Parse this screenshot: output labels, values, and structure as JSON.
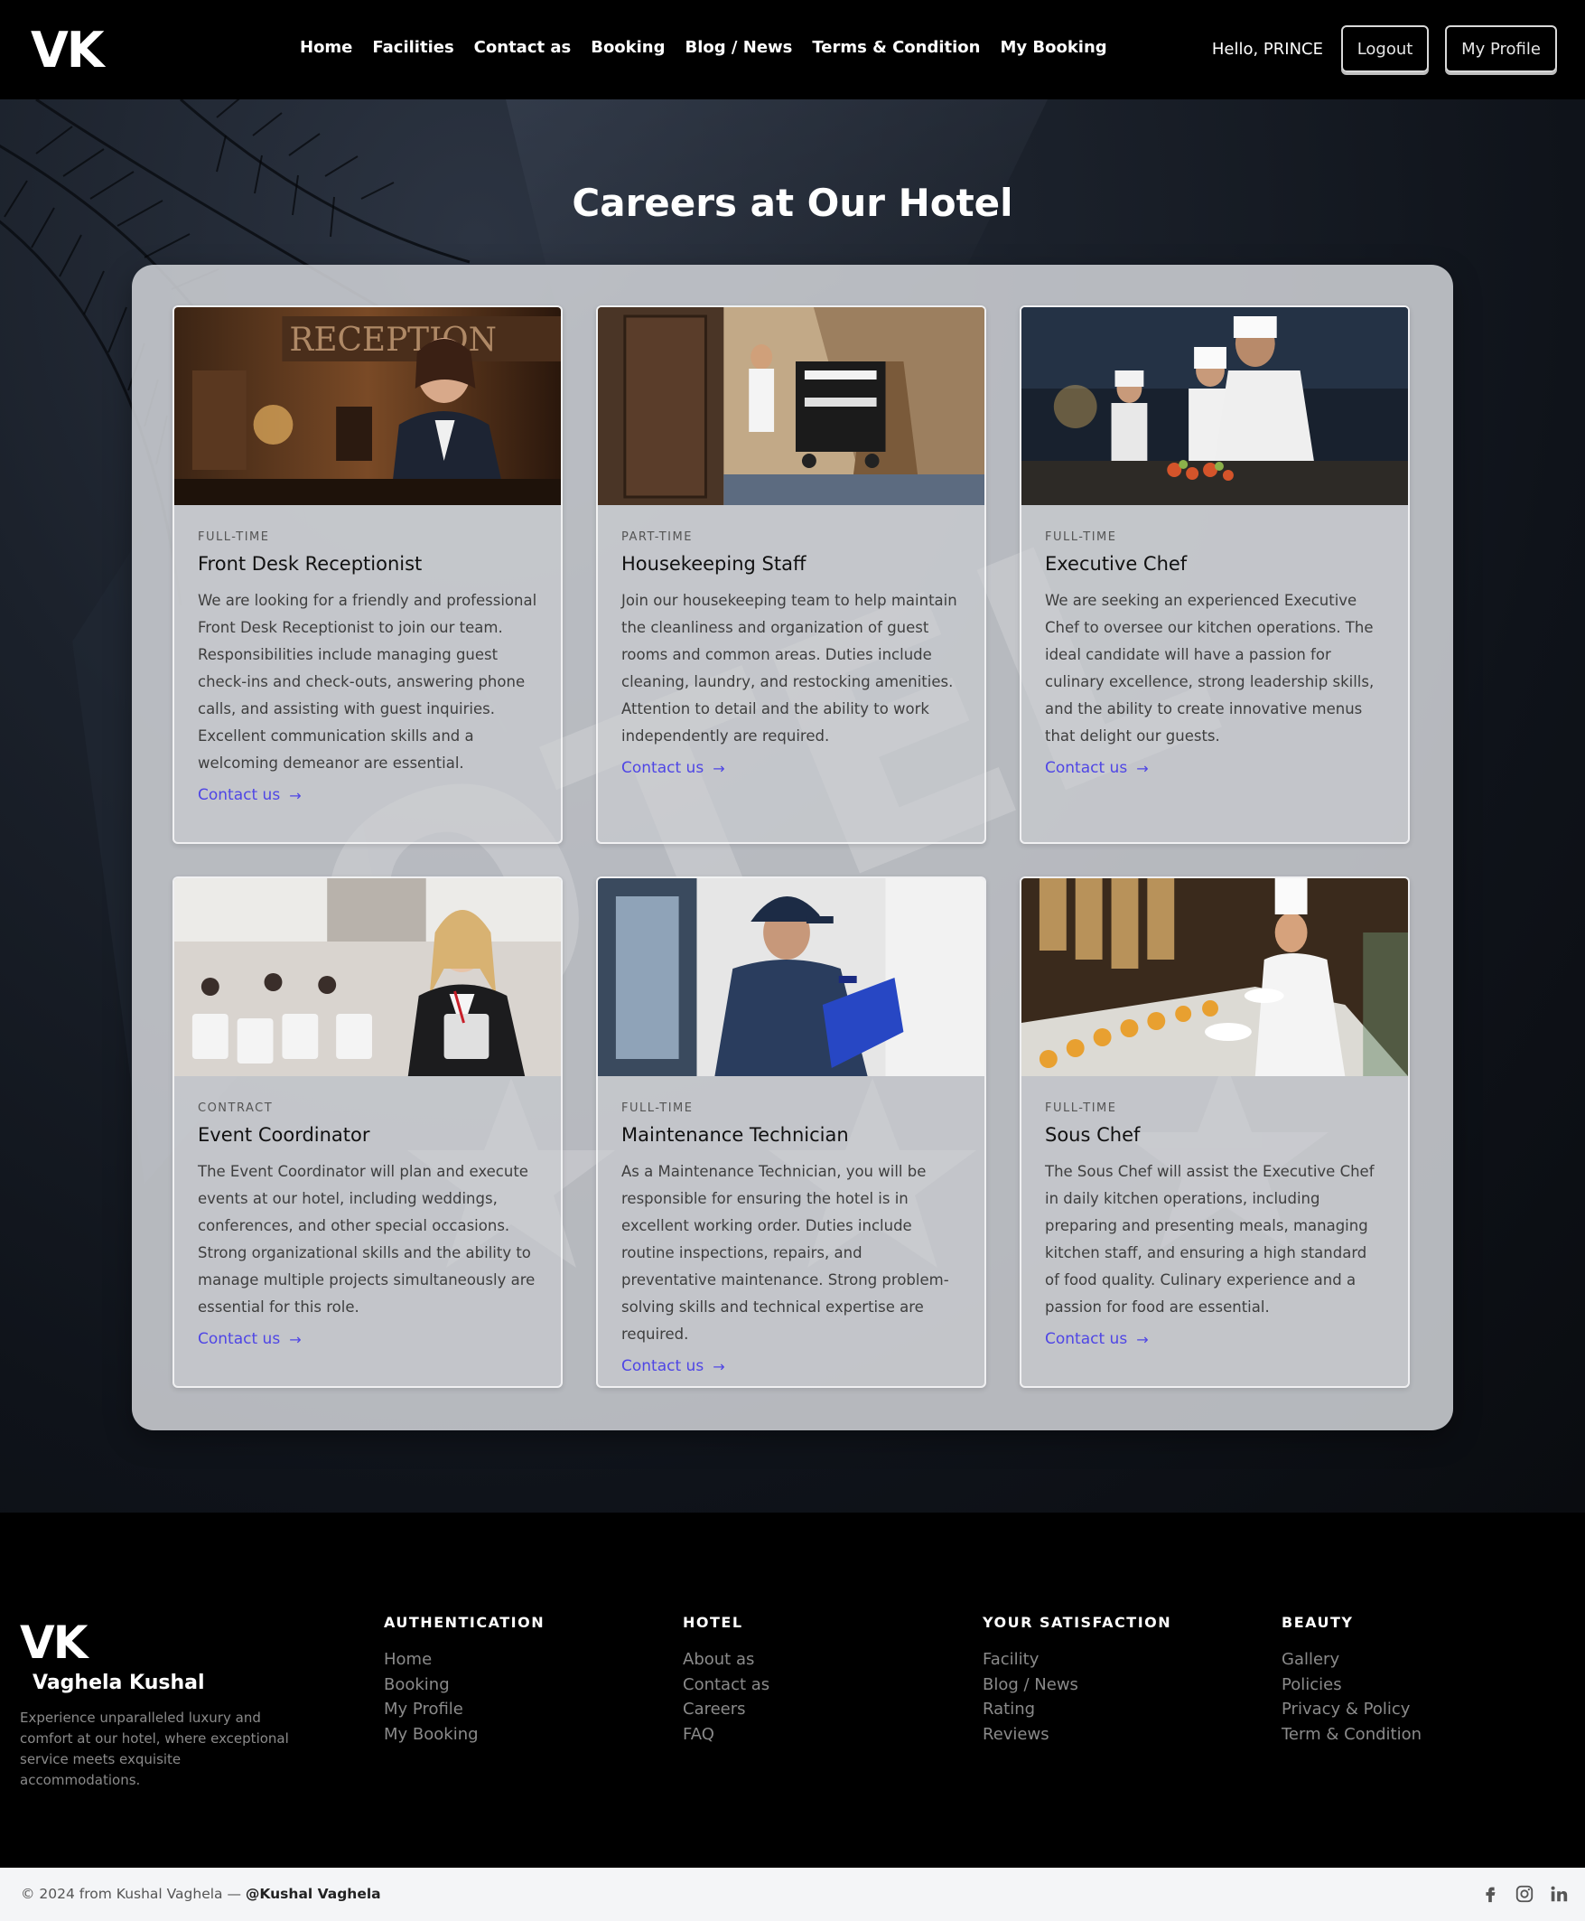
{
  "navbar": {
    "logo": "VK",
    "links": [
      "Home",
      "Facilities",
      "Contact as",
      "Booking",
      "Blog / News",
      "Terms & Condition",
      "My Booking"
    ],
    "greeting": "Hello, PRINCE",
    "logout_label": "Logout",
    "profile_label": "My Profile"
  },
  "hero": {
    "title": "Careers at Our Hotel"
  },
  "jobs": [
    {
      "type": "FULL-TIME",
      "title": "Front Desk Receptionist",
      "description": "We are looking for a friendly and professional Front Desk Receptionist to join our team. Responsibilities include managing guest check-ins and check-outs, answering phone calls, and assisting with guest inquiries. Excellent communication skills and a welcoming demeanor are essential.",
      "link": "Contact us",
      "image_sign": "RECEPTION"
    },
    {
      "type": "PART-TIME",
      "title": "Housekeeping Staff",
      "description": "Join our housekeeping team to help maintain the cleanliness and organization of guest rooms and common areas. Duties include cleaning, laundry, and restocking amenities. Attention to detail and the ability to work independently are required.",
      "link": "Contact us"
    },
    {
      "type": "FULL-TIME",
      "title": "Executive Chef",
      "description": "We are seeking an experienced Executive Chef to oversee our kitchen operations. The ideal candidate will have a passion for culinary excellence, strong leadership skills, and the ability to create innovative menus that delight our guests.",
      "link": "Contact us"
    },
    {
      "type": "CONTRACT",
      "title": "Event Coordinator",
      "description": "The Event Coordinator will plan and execute events at our hotel, including weddings, conferences, and other special occasions. Strong organizational skills and the ability to manage multiple projects simultaneously are essential for this role.",
      "link": "Contact us"
    },
    {
      "type": "FULL-TIME",
      "title": "Maintenance Technician",
      "description": "As a Maintenance Technician, you will be responsible for ensuring the hotel is in excellent working order. Duties include routine inspections, repairs, and preventative maintenance. Strong problem-solving skills and technical expertise are required.",
      "link": "Contact us"
    },
    {
      "type": "FULL-TIME",
      "title": "Sous Chef",
      "description": "The Sous Chef will assist the Executive Chef in daily kitchen operations, including preparing and presenting meals, managing kitchen staff, and ensuring a high standard of food quality. Culinary experience and a passion for food are essential.",
      "link": "Contact us"
    }
  ],
  "footer": {
    "logo": "VK",
    "name": "Vaghela Kushal",
    "description": "Experience unparalleled luxury and comfort at our hotel, where exceptional service meets exquisite accommodations.",
    "columns": [
      {
        "title": "AUTHENTICATION",
        "links": [
          "Home",
          "Booking",
          "My Profile",
          "My Booking"
        ]
      },
      {
        "title": "HOTEL",
        "links": [
          "About as",
          "Contact as",
          "Careers",
          "FAQ"
        ]
      },
      {
        "title": "YOUR SATISFACTION",
        "links": [
          "Facility",
          "Blog / News",
          "Rating",
          "Reviews"
        ]
      },
      {
        "title": "BEAUTY",
        "links": [
          "Gallery",
          "Policies",
          "Privacy & Policy",
          "Term & Condition"
        ]
      }
    ],
    "copyright_prefix": "© 2024 from Kushal Vaghela — ",
    "copyright_handle": "@Kushal Vaghela",
    "social_icons": [
      "facebook-icon",
      "instagram-icon",
      "linkedin-icon"
    ]
  },
  "colors": {
    "accent_link": "#4f46e5",
    "navbar_bg": "#000000",
    "panel_bg": "#d2d4d8"
  }
}
